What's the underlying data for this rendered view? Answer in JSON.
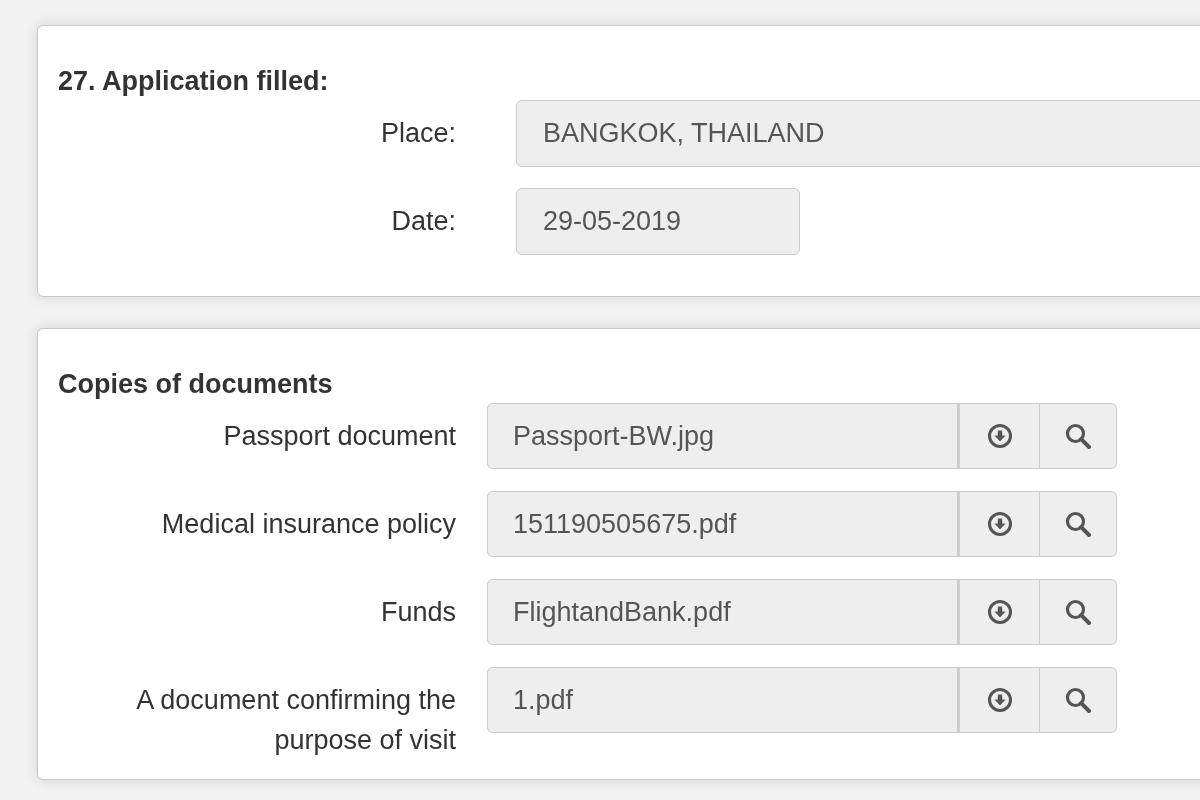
{
  "sections": [
    {
      "kind": "fields",
      "title": "27. Application filled:",
      "fields": [
        {
          "kind": "text",
          "label": "Place:",
          "value": "BANGKOK, THAILAND"
        },
        {
          "kind": "date",
          "label": "Date:",
          "value": "29-05-2019"
        }
      ]
    },
    {
      "kind": "documents",
      "title": "Copies of documents",
      "documents": [
        {
          "label": "Passport document",
          "file": "Passport-BW.jpg"
        },
        {
          "label": "Medical insurance policy",
          "file": "151190505675.pdf"
        },
        {
          "label": "Funds",
          "file": "FlightandBank.pdf"
        },
        {
          "label": "A document confirming the purpose of visit",
          "file": "1.pdf"
        }
      ]
    }
  ]
}
